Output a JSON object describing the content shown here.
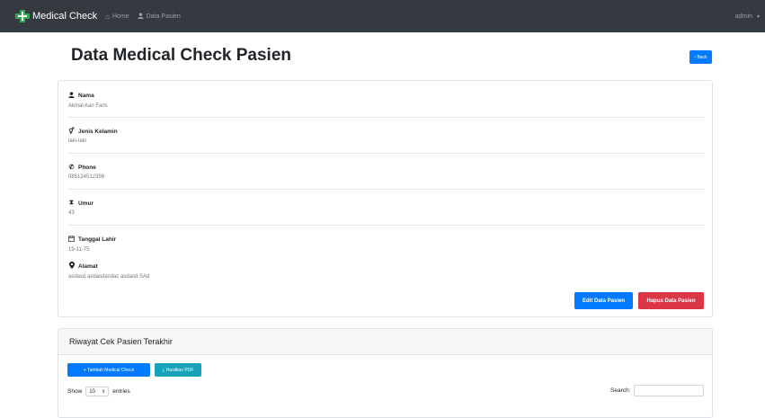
{
  "navbar": {
    "brand": "Medical Check",
    "home": "Home",
    "data_pasien": "Data Pasien",
    "user": "admin",
    "brand_color": "#2fa84f"
  },
  "page": {
    "title": "Data Medical Check Pasien",
    "back": "‹ Back"
  },
  "patient": {
    "nama_label": "Nama",
    "nama_value": "Akmal Aan Faris",
    "gender_label": "Jenis Kelamin",
    "gender_value": "laki-laki",
    "phone_label": "Phone",
    "phone_value": "085124512356",
    "umur_label": "Umur",
    "umur_value": "43",
    "lahir_label": "Tanggal Lahir",
    "lahir_value": "19-11-75",
    "alamat_label": "Alamat",
    "alamat_value": "asdasd asdasdasdac asdasd SAd"
  },
  "actions": {
    "edit": "Edit Data Pasien",
    "hapus": "Hapus Data Pasien"
  },
  "riwayat": {
    "title": "Riwayat Cek Pasien Terakhir",
    "tambah": "+ Tambah Medical Check",
    "pdf": "Hasilkan PDF",
    "show": "Show",
    "entries_value": "10",
    "entries": "entries",
    "search": "Search:"
  },
  "icons": {
    "user": "user-icon",
    "gender": "venus-mars-icon",
    "phone": "phone-icon",
    "umur": "hourglass-icon",
    "lahir": "calendar-icon",
    "alamat": "map-marker-icon"
  }
}
